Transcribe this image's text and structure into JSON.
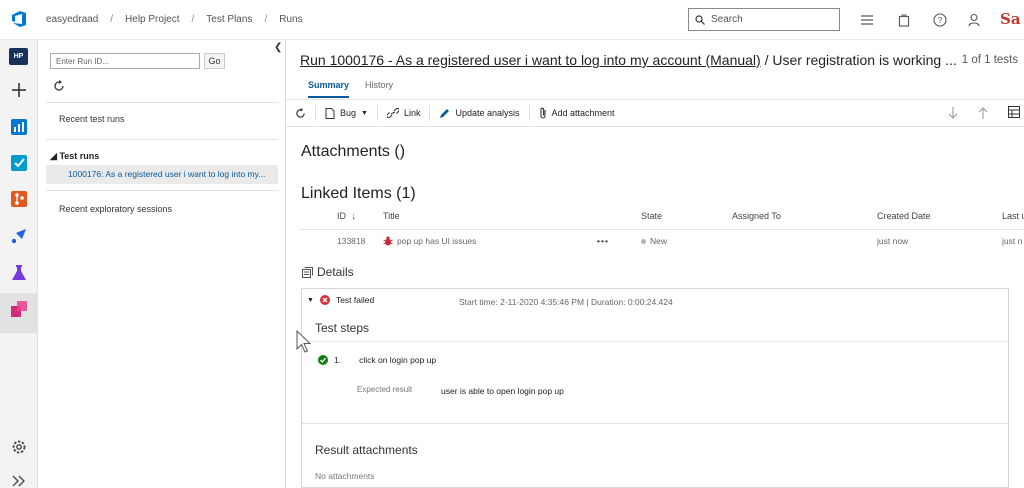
{
  "topbar": {
    "breadcrumbs": [
      "easyedraad",
      "Help Project",
      "Test Plans",
      "Runs"
    ],
    "search_placeholder": "Search",
    "brand_text": "Sa"
  },
  "rail": {
    "project_badge": "HP"
  },
  "side": {
    "run_id_placeholder": "Enter Run ID...",
    "go_label": "Go",
    "recent_test_runs": "Recent test runs",
    "test_runs_header": "Test runs",
    "selected_run": "1000176: As a registered user i want to log into my...",
    "recent_exploratory": "Recent exploratory sessions"
  },
  "main": {
    "title_link": "Run 1000176 - As a registered user i want to log into my account (Manual)",
    "title_rest": " / User registration is working ...",
    "counter": "1 of 1 tests",
    "tabs": [
      "Summary",
      "History"
    ],
    "toolbar": {
      "bug": "Bug",
      "link": "Link",
      "update_analysis": "Update analysis",
      "add_attachment": "Add attachment"
    },
    "attachments_heading": "Attachments ()",
    "linked_items_heading": "Linked Items (1)",
    "columns": [
      "ID",
      "Title",
      "State",
      "Assigned To",
      "Created Date",
      "Last u"
    ],
    "linked_row": {
      "id": "133818",
      "title": "pop up has UI issues",
      "more": "•••",
      "state": "New",
      "created": "just now",
      "last": "just n"
    },
    "details_heading": "Details",
    "result_text": "Test failed",
    "start_time": "Start time: 2-11-2020 4:35:46 PM | Duration: 0:00:24.424",
    "steps_heading": "Test steps",
    "step_number": "1.",
    "step_action": "click on login pop up",
    "expected_label": "Expected result",
    "expected_value": "user is able to open login pop up",
    "result_attachments_heading": "Result attachments",
    "no_attachments": "No attachments"
  },
  "colors": {
    "accent": "#0a5a9c",
    "fail_red": "#d13438",
    "pass_green": "#107c10",
    "bug_red": "#cc293d"
  }
}
